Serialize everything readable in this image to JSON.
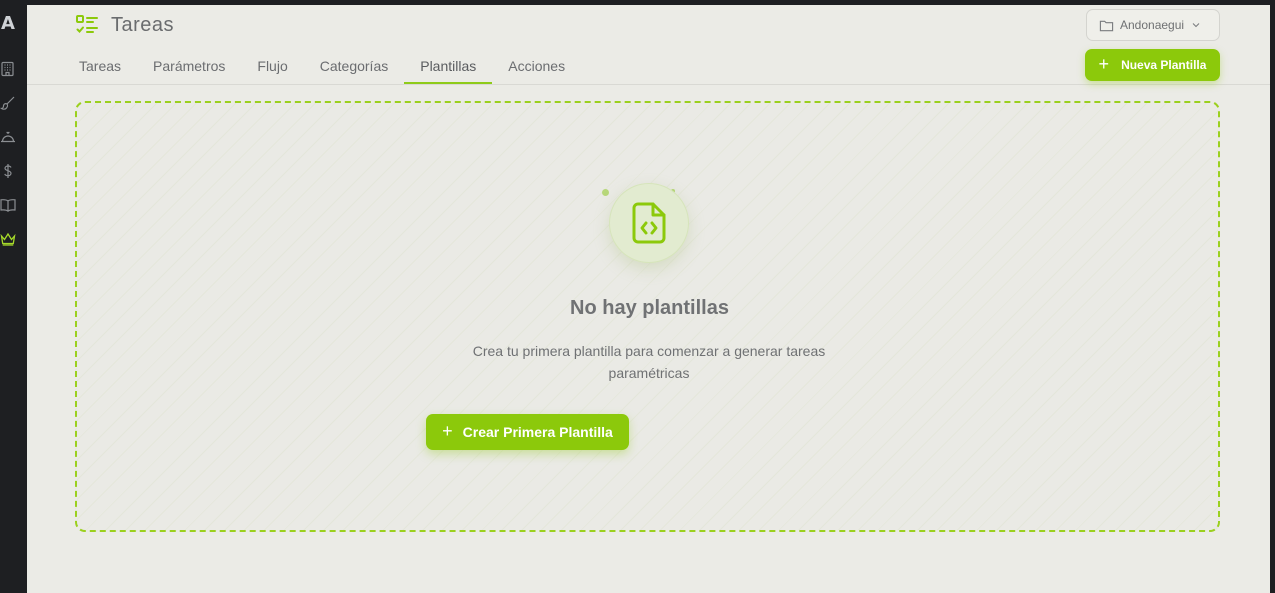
{
  "app": {
    "logo_letter": "A",
    "title": "Tareas"
  },
  "sidebar": {
    "items": [
      {
        "icon": "building-icon",
        "active": false
      },
      {
        "icon": "brush-icon",
        "active": false
      },
      {
        "icon": "service-bell-icon",
        "active": false
      },
      {
        "icon": "dollar-icon",
        "active": false
      },
      {
        "icon": "book-open-icon",
        "active": false
      },
      {
        "icon": "crown-icon",
        "active": true
      }
    ]
  },
  "header": {
    "project_select": "Andonaegui",
    "new_button_label": "Nueva Plantilla"
  },
  "tabs": [
    {
      "label": "Tareas",
      "active": false
    },
    {
      "label": "Parámetros",
      "active": false
    },
    {
      "label": "Flujo",
      "active": false
    },
    {
      "label": "Categorías",
      "active": false
    },
    {
      "label": "Plantillas",
      "active": true
    },
    {
      "label": "Acciones",
      "active": false
    }
  ],
  "empty_state": {
    "icon": "file-code-icon",
    "title": "No hay plantillas",
    "description": "Crea tu primera plantilla para comenzar a generar tareas paramétricas",
    "button_label": "Crear Primera Plantilla"
  },
  "colors": {
    "accent": "#8cc90b",
    "background": "#ebebe6",
    "sidebar": "#1e1f22"
  }
}
